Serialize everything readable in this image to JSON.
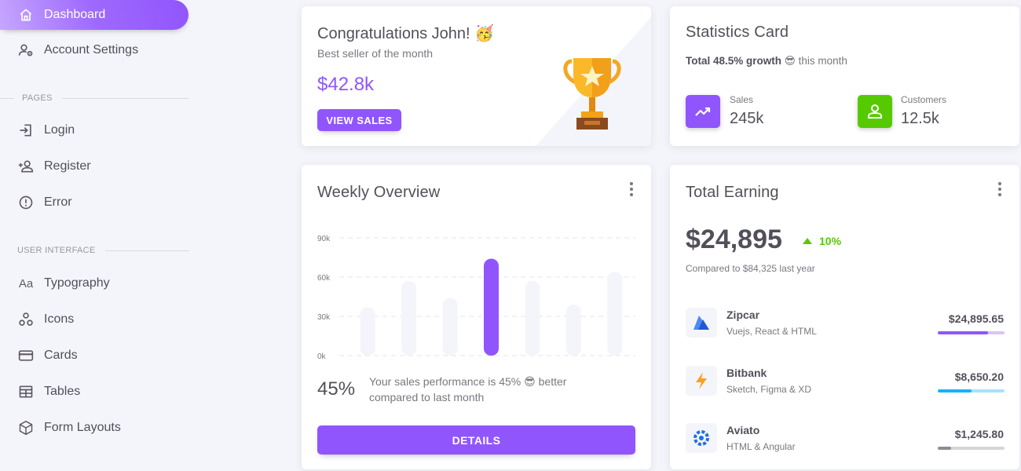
{
  "sidebar": {
    "items": [
      {
        "label": "Dashboard",
        "icon": "home-icon",
        "active": true
      },
      {
        "label": "Account Settings",
        "icon": "account-cog-icon"
      }
    ],
    "sections": [
      {
        "title": "PAGES",
        "items": [
          {
            "label": "Login",
            "icon": "login-icon"
          },
          {
            "label": "Register",
            "icon": "account-plus-icon"
          },
          {
            "label": "Error",
            "icon": "alert-circle-icon"
          }
        ]
      },
      {
        "title": "USER INTERFACE",
        "items": [
          {
            "label": "Typography",
            "icon": "format-letter-case-icon"
          },
          {
            "label": "Icons",
            "icon": "google-circles-icon"
          },
          {
            "label": "Cards",
            "icon": "credit-card-icon"
          },
          {
            "label": "Tables",
            "icon": "table-icon"
          },
          {
            "label": "Form Layouts",
            "icon": "cube-outline-icon"
          }
        ]
      }
    ]
  },
  "congrats": {
    "title": "Congratulations John! 🥳",
    "subtitle": "Best seller of the month",
    "amount": "$42.8k",
    "button": "VIEW SALES",
    "icon": "trophy-icon"
  },
  "statistics": {
    "title": "Statistics Card",
    "growth_bold": "Total 48.5% growth",
    "growth_emoji": "😎",
    "growth_suffix": "this month",
    "items": [
      {
        "label": "Sales",
        "value": "245k",
        "color": "#9155fd",
        "icon": "trending-up-icon"
      },
      {
        "label": "Customers",
        "value": "12.5k",
        "color": "#56ca00",
        "icon": "account-outline-icon"
      }
    ]
  },
  "weekly": {
    "title": "Weekly Overview",
    "percent": "45%",
    "text": "Your sales performance is 45% 😎 better compared to last month",
    "button": "DETAILS"
  },
  "chart_data": {
    "type": "bar",
    "categories": [
      "",
      "",
      "",
      "",
      "",
      "",
      ""
    ],
    "values": [
      37,
      57,
      44,
      74,
      57,
      39,
      64
    ],
    "highlight_index": 3,
    "ylim": [
      0,
      90
    ],
    "yticks": [
      "0k",
      "30k",
      "60k",
      "90k"
    ],
    "ytick_values": [
      0,
      30,
      60,
      90
    ],
    "bar_color": "#f4f5fa",
    "highlight_color": "#9155fd",
    "grid": true
  },
  "earning": {
    "title": "Total Earning",
    "amount": "$24,895",
    "change": "10%",
    "change_color": "#56ca00",
    "compare": "Compared to $84,325 last year",
    "items": [
      {
        "name": "Zipcar",
        "sub": "Vuejs, React & HTML",
        "amount": "$24,895.65",
        "progress": 0.75,
        "color": "#9155fd",
        "track": "#d7c5fe",
        "icon": "zipcar-logo-icon"
      },
      {
        "name": "Bitbank",
        "sub": "Sketch, Figma & XD",
        "amount": "$8,650.20",
        "progress": 0.5,
        "color": "#16b1ff",
        "track": "#a8e0ff",
        "icon": "bitbank-logo-icon"
      },
      {
        "name": "Aviato",
        "sub": "HTML & Angular",
        "amount": "$1,245.80",
        "progress": 0.2,
        "color": "#8a8d93",
        "track": "#d5d6d8",
        "icon": "aviato-logo-icon"
      }
    ]
  }
}
